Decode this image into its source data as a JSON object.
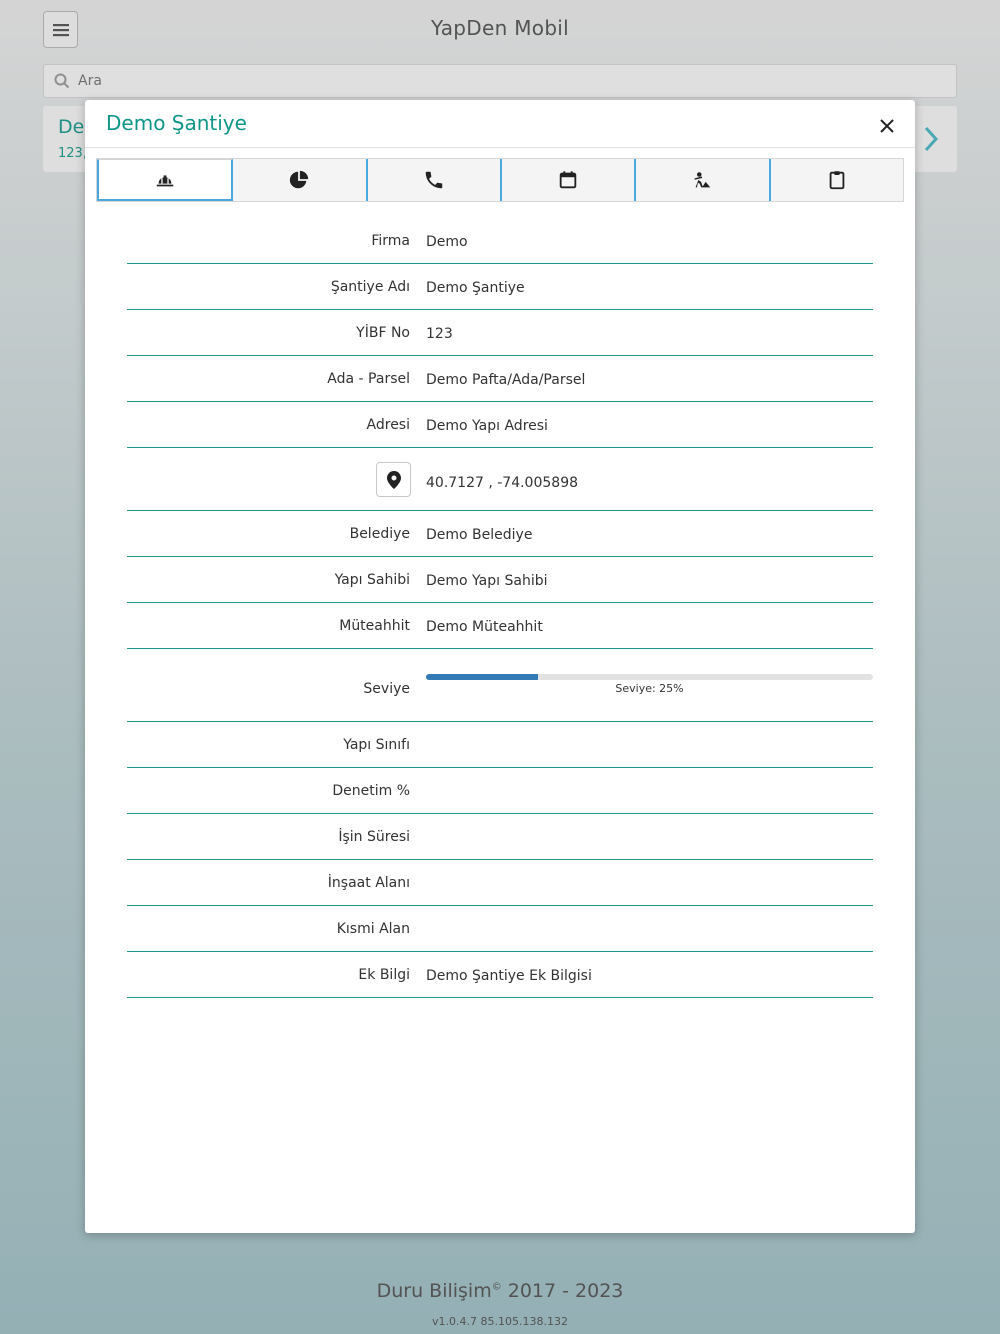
{
  "app": {
    "title": "YapDen Mobil",
    "search_placeholder": "Ara",
    "bg_card_title": "De",
    "bg_card_sub": "123,",
    "footer_text": "Duru Bilişim",
    "footer_copyright": "©",
    "footer_years": " 2017 - 2023",
    "version": "v1.0.4.7 85.105.138.132"
  },
  "modal": {
    "title": "Demo Şantiye",
    "tabs": [
      {
        "icon": "helmet-icon",
        "active": true
      },
      {
        "icon": "pie-chart-icon",
        "active": false
      },
      {
        "icon": "phone-icon",
        "active": false
      },
      {
        "icon": "calendar-icon",
        "active": false
      },
      {
        "icon": "worker-icon",
        "active": false
      },
      {
        "icon": "clipboard-icon",
        "active": false
      }
    ],
    "fields": {
      "firma": {
        "label": "Firma",
        "value": "Demo"
      },
      "santiye_adi": {
        "label": "Şantiye Adı",
        "value": "Demo Şantiye"
      },
      "yibf_no": {
        "label": "YİBF No",
        "value": "123"
      },
      "ada_parsel": {
        "label": "Ada - Parsel",
        "value": "Demo Pafta/Ada/Parsel"
      },
      "adresi": {
        "label": "Adresi",
        "value": "Demo Yapı Adresi"
      },
      "koordinat": {
        "value": "40.7127 , -74.005898"
      },
      "belediye": {
        "label": "Belediye",
        "value": "Demo Belediye"
      },
      "yapi_sahibi": {
        "label": "Yapı Sahibi",
        "value": "Demo Yapı Sahibi"
      },
      "muteahhit": {
        "label": "Müteahhit",
        "value": "Demo Müteahhit"
      },
      "seviye": {
        "label": "Seviye",
        "percent": 25,
        "text": "Seviye: 25%"
      },
      "yapi_sinifi": {
        "label": "Yapı Sınıfı",
        "value": ""
      },
      "denetim": {
        "label": "Denetim %",
        "value": ""
      },
      "isin_suresi": {
        "label": "İşin Süresi",
        "value": ""
      },
      "insaat_alani": {
        "label": "İnşaat Alanı",
        "value": ""
      },
      "kismi_alan": {
        "label": "Kısmi Alan",
        "value": ""
      },
      "ek_bilgi": {
        "label": "Ek Bilgi",
        "value": "Demo Şantiye Ek Bilgisi"
      }
    }
  },
  "colors": {
    "accent": "#109688",
    "tab_border": "#4aa8e0",
    "progress": "#337ab7"
  }
}
